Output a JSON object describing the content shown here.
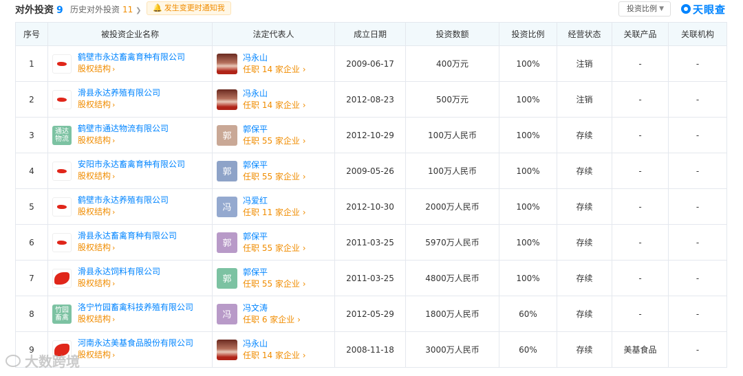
{
  "header": {
    "title": "对外投资",
    "count": "9",
    "history_label": "历史对外投资",
    "history_count": "11",
    "history_chevron": "❯",
    "notify_label": "发生变更时通知我",
    "sort_label": "投资比例",
    "brand": "天眼查"
  },
  "columns": [
    "序号",
    "被投资企业名称",
    "法定代表人",
    "成立日期",
    "投资数额",
    "投资比例",
    "经营状态",
    "关联产品",
    "关联机构"
  ],
  "sub_link_label": "股权结构",
  "rows": [
    {
      "no": "1",
      "company": "鹤壁市永达畜禽育种有限公司",
      "logo_type": "img",
      "logo_text": "",
      "rep": "冯永山",
      "rep_avatar": "photo",
      "rep_char": "",
      "rep_color": "",
      "rep_count": "任职 14 家企业",
      "date": "2009-06-17",
      "amount": "400万元",
      "ratio": "100%",
      "status": "注销",
      "status_type": "cancel",
      "product": "-",
      "org": "-"
    },
    {
      "no": "2",
      "company": "滑县永达养殖有限公司",
      "logo_type": "img",
      "logo_text": "",
      "rep": "冯永山",
      "rep_avatar": "photo",
      "rep_char": "",
      "rep_color": "",
      "rep_count": "任职 14 家企业",
      "date": "2012-08-23",
      "amount": "500万元",
      "ratio": "100%",
      "status": "注销",
      "status_type": "cancel",
      "product": "-",
      "org": "-"
    },
    {
      "no": "3",
      "company": "鹤壁市通达物流有限公司",
      "logo_type": "green",
      "logo_text": "通达物流",
      "rep": "郭保平",
      "rep_avatar": "char",
      "rep_char": "郭",
      "rep_color": "#c9a896",
      "rep_count": "任职 55 家企业",
      "date": "2012-10-29",
      "amount": "100万人民币",
      "ratio": "100%",
      "status": "存续",
      "status_type": "active",
      "product": "-",
      "org": "-"
    },
    {
      "no": "4",
      "company": "安阳市永达畜禽育种有限公司",
      "logo_type": "img",
      "logo_text": "",
      "rep": "郭保平",
      "rep_avatar": "char",
      "rep_char": "郭",
      "rep_color": "#8ea3c8",
      "rep_count": "任职 55 家企业",
      "date": "2009-05-26",
      "amount": "100万人民币",
      "ratio": "100%",
      "status": "存续",
      "status_type": "active",
      "product": "-",
      "org": "-"
    },
    {
      "no": "5",
      "company": "鹤壁市永达养殖有限公司",
      "logo_type": "img",
      "logo_text": "",
      "rep": "冯爱红",
      "rep_avatar": "char",
      "rep_char": "冯",
      "rep_color": "#94a9cf",
      "rep_count": "任职 11 家企业",
      "date": "2012-10-30",
      "amount": "2000万人民币",
      "ratio": "100%",
      "status": "存续",
      "status_type": "active",
      "product": "-",
      "org": "-"
    },
    {
      "no": "6",
      "company": "滑县永达畜禽育种有限公司",
      "logo_type": "img",
      "logo_text": "",
      "rep": "郭保平",
      "rep_avatar": "char",
      "rep_char": "郭",
      "rep_color": "#b89ac8",
      "rep_count": "任职 55 家企业",
      "date": "2011-03-25",
      "amount": "5970万人民币",
      "ratio": "100%",
      "status": "存续",
      "status_type": "active",
      "product": "-",
      "org": "-"
    },
    {
      "no": "7",
      "company": "滑县永达饲料有限公司",
      "logo_type": "big",
      "logo_text": "",
      "rep": "郭保平",
      "rep_avatar": "char",
      "rep_char": "郭",
      "rep_color": "#7cc2a2",
      "rep_count": "任职 55 家企业",
      "date": "2011-03-25",
      "amount": "4800万人民币",
      "ratio": "100%",
      "status": "存续",
      "status_type": "active",
      "product": "-",
      "org": "-"
    },
    {
      "no": "8",
      "company": "洛宁竹园畜禽科技养殖有限公司",
      "logo_type": "green",
      "logo_text": "竹园畜禽",
      "rep": "冯文涛",
      "rep_avatar": "char",
      "rep_char": "冯",
      "rep_color": "#b89ac8",
      "rep_count": "任职 6 家企业",
      "date": "2012-05-29",
      "amount": "1800万人民币",
      "ratio": "60%",
      "status": "存续",
      "status_type": "active",
      "product": "-",
      "org": "-"
    },
    {
      "no": "9",
      "company": "河南永达美基食品股份有限公司",
      "logo_type": "big",
      "logo_text": "",
      "rep": "冯永山",
      "rep_avatar": "photo",
      "rep_char": "",
      "rep_color": "",
      "rep_count": "任职 14 家企业",
      "date": "2008-11-18",
      "amount": "3000万人民币",
      "ratio": "60%",
      "status": "存续",
      "status_type": "active",
      "product": "美基食品",
      "org": "-"
    }
  ],
  "watermark": "大数跨境"
}
